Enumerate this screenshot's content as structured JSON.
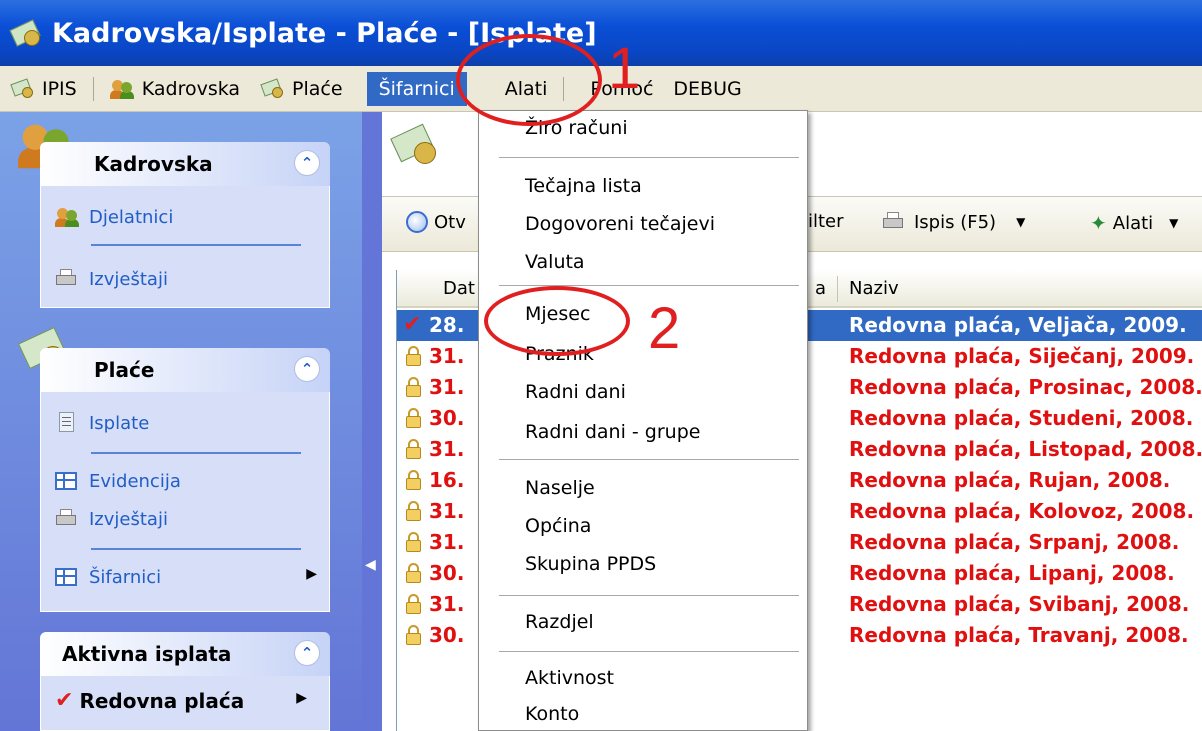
{
  "window": {
    "title": "Kadrovska/Isplate - Plaće - [Isplate]"
  },
  "menubar": {
    "items": [
      {
        "label": "IPIS"
      },
      {
        "label": "Kadrovska"
      },
      {
        "label": "Plaće"
      },
      {
        "label": "Šifarnici"
      },
      {
        "label": "Alati"
      },
      {
        "label": "Pomoć"
      },
      {
        "label": "DEBUG"
      }
    ]
  },
  "sidebar": {
    "kadrovska": {
      "title": "Kadrovska",
      "items": [
        "Djelatnici",
        "Izvještaji"
      ]
    },
    "place": {
      "title": "Plaće",
      "items": [
        "Isplate",
        "Evidencija",
        "Izvještaji",
        "Šifarnici"
      ]
    },
    "aktivna": {
      "title": "Aktivna isplata",
      "item": "Redovna plaća"
    }
  },
  "toolbar": {
    "open_label": "Otv",
    "filter_label": "ilter",
    "print_label": "Ispis (F5)",
    "tools_label": "Alati"
  },
  "table": {
    "col_date": "Dat",
    "col_a": "a",
    "col_name": "Naziv",
    "rows": [
      {
        "date": "28.",
        "name": "Redovna plaća, Veljača, 2009.",
        "status": "selected"
      },
      {
        "date": "31.",
        "name": "Redovna plaća, Siječanj, 2009.",
        "status": "locked"
      },
      {
        "date": "31.",
        "name": "Redovna plaća, Prosinac, 2008.",
        "status": "locked"
      },
      {
        "date": "30.",
        "name": "Redovna plaća, Studeni, 2008.",
        "status": "locked"
      },
      {
        "date": "31.",
        "name": "Redovna plaća, Listopad, 2008.",
        "status": "locked"
      },
      {
        "date": "16.",
        "name": "Redovna plaća, Rujan, 2008.",
        "status": "locked"
      },
      {
        "date": "31.",
        "name": "Redovna plaća, Kolovoz, 2008.",
        "status": "locked"
      },
      {
        "date": "31.",
        "name": "Redovna plaća, Srpanj, 2008.",
        "status": "locked"
      },
      {
        "date": "30.",
        "name": "Redovna plaća, Lipanj, 2008.",
        "status": "locked"
      },
      {
        "date": "31.",
        "name": "Redovna plaća, Svibanj, 2008.",
        "status": "locked"
      },
      {
        "date": "30.",
        "name": "Redovna plaća, Travanj, 2008.",
        "status": "locked"
      }
    ]
  },
  "dropdown": {
    "items": [
      "Žiro računi",
      "Tečajna lista",
      "Dogovoreni tečajevi",
      "Valuta",
      "Mjesec",
      "Praznik",
      "Radni dani",
      "Radni dani - grupe",
      "Naselje",
      "Općina",
      "Skupina PPDS",
      "Razdjel",
      "Aktivnost",
      "Konto"
    ]
  },
  "annotations": {
    "step1": "1",
    "step2": "2"
  },
  "colors": {
    "titlebar": "#0a4fd6",
    "menu_highlight": "#316ac5",
    "annotation": "#e02020",
    "row_text": "#e01010"
  }
}
